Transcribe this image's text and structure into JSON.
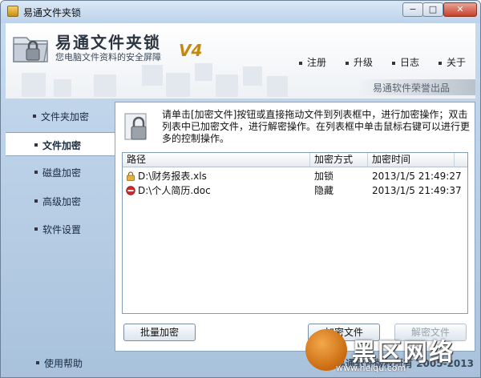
{
  "window": {
    "title": "易通文件夹锁",
    "min_glyph": "−",
    "max_glyph": "□",
    "close_glyph": "✕"
  },
  "header": {
    "logo_title": "易通文件夹锁",
    "logo_subtitle": "您电脑文件资料的安全屏障",
    "version": "V4",
    "nav": [
      "注册",
      "升级",
      "日志",
      "关于"
    ],
    "brand": "易通软件荣誉出品"
  },
  "sidebar": {
    "items": [
      {
        "label": "文件夹加密",
        "active": false
      },
      {
        "label": "文件加密",
        "active": true
      },
      {
        "label": "磁盘加密",
        "active": false
      },
      {
        "label": "高级加密",
        "active": false
      },
      {
        "label": "软件设置",
        "active": false
      }
    ],
    "help": "使用帮助"
  },
  "main": {
    "info": "请单击[加密文件]按钮或直接拖动文件到列表框中，进行加密操作；双击列表中已加密文件，进行解密操作。在列表框中单击鼠标右键可以进行更多的控制操作。",
    "columns": [
      "路径",
      "加密方式",
      "加密时间"
    ],
    "rows": [
      {
        "path": "D:\\财务报表.xls",
        "method": "加锁",
        "time": "2013/1/5 21:49:27",
        "icon": "lock-icon"
      },
      {
        "path": "D:\\个人简历.doc",
        "method": "隐藏",
        "time": "2013/1/5 21:49:37",
        "icon": "hidden-icon"
      }
    ],
    "batch_button": "批量加密",
    "encrypt_button": "加密文件",
    "decrypt_button": "解密文件"
  },
  "footer": {
    "copyright": "易通软件版权所有 2005-2013",
    "watermark_text": "黑区网络",
    "watermark_url": "www.heiqu.com"
  },
  "colors": {
    "accent": "#c48a10",
    "panel_border": "#8aa4c2",
    "hidden_icon": "#d42a2a",
    "lock_icon": "#e6b33a"
  }
}
